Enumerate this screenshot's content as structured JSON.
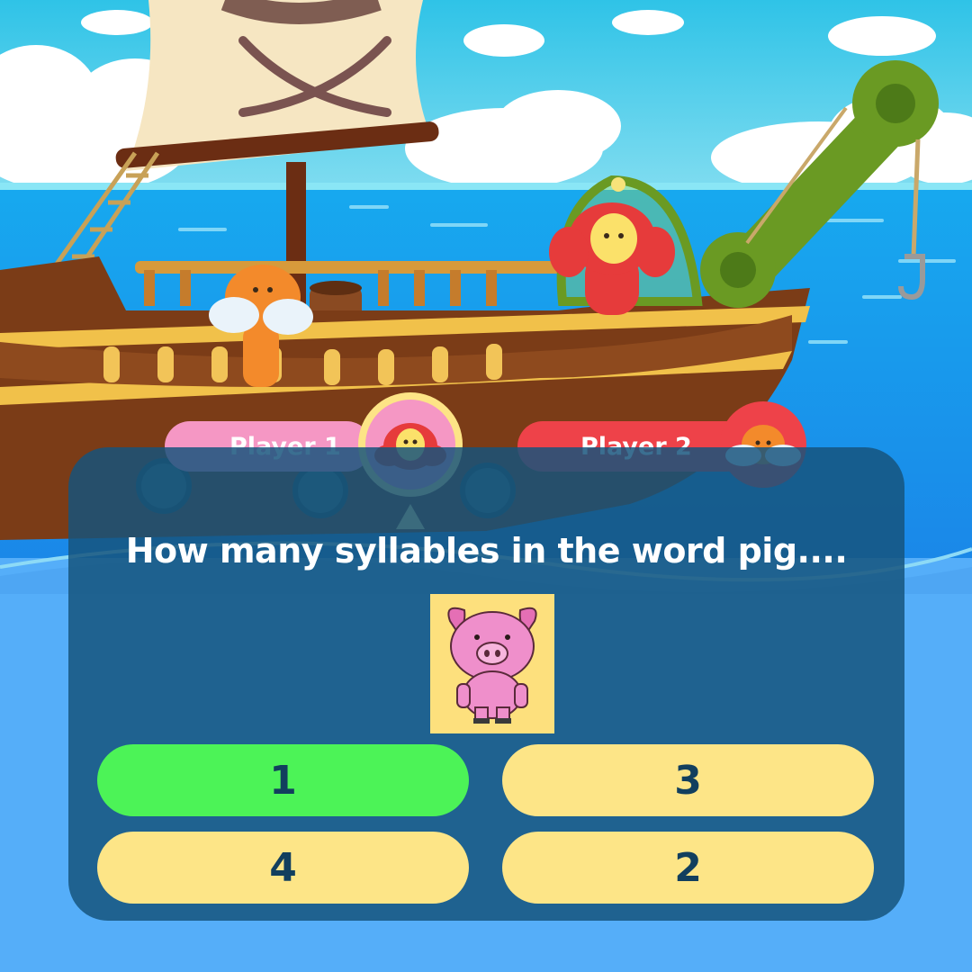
{
  "players": [
    {
      "label": "Player 1",
      "color": "#f597c4"
    },
    {
      "label": "Player 2",
      "color": "#ee4249"
    }
  ],
  "question": {
    "text": "How many syllables in the word pig....",
    "image_icon": "pig-icon"
  },
  "answers": [
    {
      "label": "1",
      "state": "correct",
      "color": "#4cf357"
    },
    {
      "label": "3",
      "state": "default",
      "color": "#fde587"
    },
    {
      "label": "4",
      "state": "default",
      "color": "#fde587"
    },
    {
      "label": "2",
      "state": "default",
      "color": "#fde587"
    }
  ],
  "colors": {
    "sky": "#2ec1e6",
    "sea": "#55aef9",
    "panel": "#16547c",
    "answer_text": "#123f5e"
  }
}
